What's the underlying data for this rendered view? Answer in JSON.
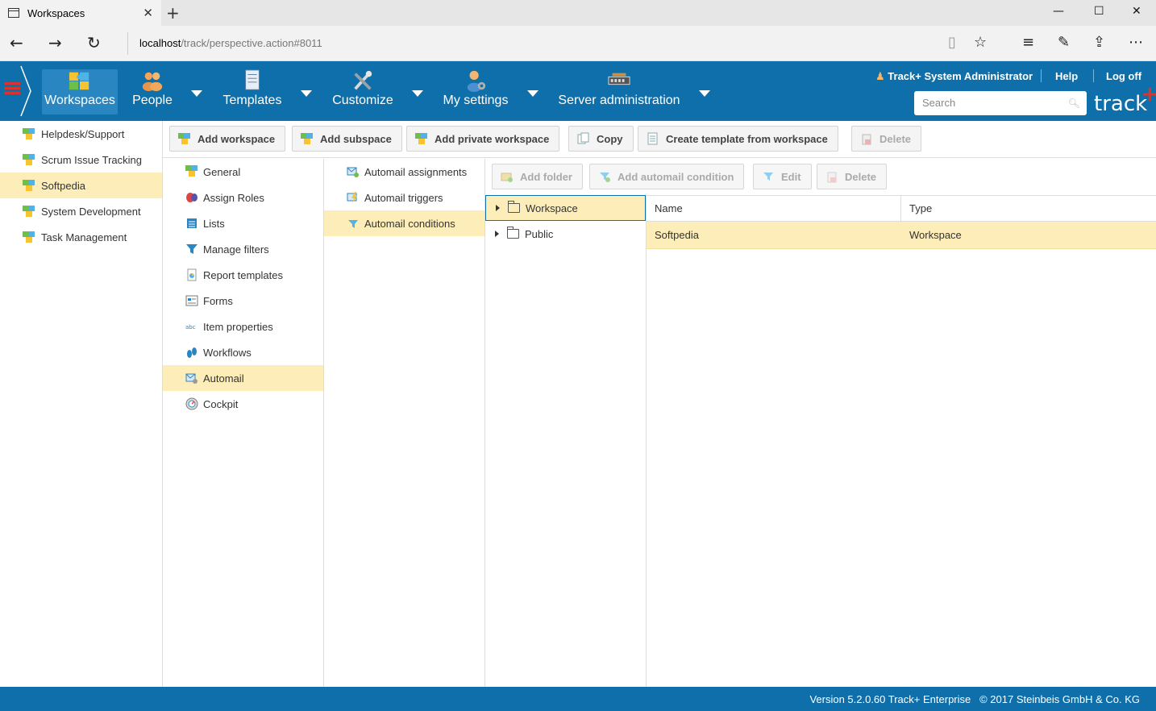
{
  "browser": {
    "tab_title": "Workspaces",
    "url_host": "localhost",
    "url_path": "/track/perspective.action#8011"
  },
  "header": {
    "nav": [
      {
        "label": "Workspaces",
        "icon": "workspaces-icon",
        "active": true
      },
      {
        "label": "People",
        "icon": "people-icon"
      },
      {
        "label": "Templates",
        "icon": "templates-icon"
      },
      {
        "label": "Customize",
        "icon": "customize-icon"
      },
      {
        "label": "My settings",
        "icon": "my-settings-icon"
      },
      {
        "label": "Server administration",
        "icon": "server-administration-icon"
      }
    ],
    "user": "Track+ System Administrator",
    "help": "Help",
    "logoff": "Log off",
    "search_placeholder": "Search",
    "brand": "track",
    "brand_plus": "+",
    "accent_color": "#0f6faa",
    "brand_plus_color": "#e03326"
  },
  "workspaces": [
    {
      "label": "Helpdesk/Support"
    },
    {
      "label": "Scrum Issue Tracking"
    },
    {
      "label": "Softpedia",
      "selected": true
    },
    {
      "label": "System Development"
    },
    {
      "label": "Task Management"
    }
  ],
  "toolbar": {
    "add_workspace": "Add workspace",
    "add_subspace": "Add subspace",
    "add_private_workspace": "Add private workspace",
    "copy": "Copy",
    "create_template": "Create template from workspace",
    "delete": "Delete"
  },
  "config_menu": [
    {
      "label": "General"
    },
    {
      "label": "Assign Roles"
    },
    {
      "label": "Lists"
    },
    {
      "label": "Manage filters"
    },
    {
      "label": "Report templates"
    },
    {
      "label": "Forms"
    },
    {
      "label": "Item properties"
    },
    {
      "label": "Workflows"
    },
    {
      "label": "Automail",
      "selected": true
    },
    {
      "label": "Cockpit"
    }
  ],
  "submenu": [
    {
      "label": "Automail assignments"
    },
    {
      "label": "Automail triggers"
    },
    {
      "label": "Automail conditions",
      "selected": true
    }
  ],
  "content_toolbar": {
    "add_folder": "Add folder",
    "add_condition": "Add automail condition",
    "edit": "Edit",
    "delete": "Delete"
  },
  "tree": [
    {
      "label": "Workspace",
      "selected": true
    },
    {
      "label": "Public"
    }
  ],
  "grid": {
    "columns": [
      "Name",
      "Type"
    ],
    "rows": [
      [
        "Softpedia",
        "Workspace"
      ]
    ]
  },
  "footer": {
    "version": "Version 5.2.0.60 Track+ Enterprise",
    "copyright": "© 2017 Steinbeis GmbH & Co. KG"
  }
}
